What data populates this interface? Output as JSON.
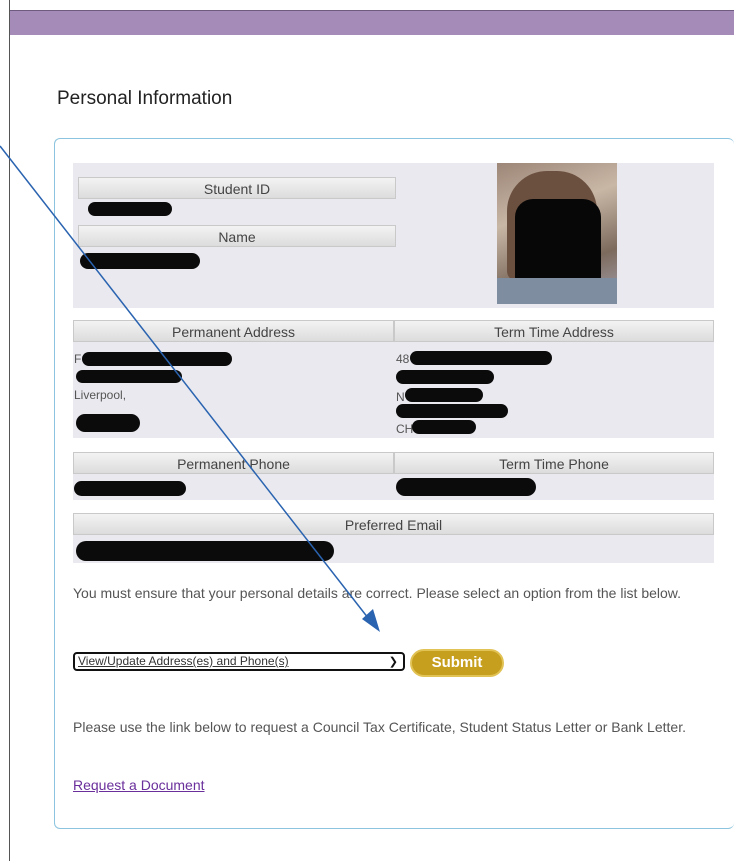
{
  "page": {
    "heading": "Personal Information"
  },
  "profile": {
    "student_id_label": "Student ID",
    "name_label": "Name",
    "photo_alt": "Student photo"
  },
  "addresses": {
    "permanent_label": "Permanent Address",
    "term_label": "Term Time Address",
    "permanent_city": "Liverpool,",
    "permanent_line1_fragment": "F",
    "term_line1_fragment": "48",
    "term_line3_fragment": "N",
    "term_line4_fragment": "CH"
  },
  "phones": {
    "permanent_label": "Permanent Phone",
    "term_label": "Term Time Phone"
  },
  "email": {
    "label": "Preferred Email"
  },
  "instructions": {
    "details_notice": "You must ensure that your personal details are correct. Please select an option from the list below.",
    "document_notice": "Please use the link below to request a Council Tax Certificate, Student Status Letter or Bank Letter."
  },
  "action_select": {
    "selected": "View/Update Address(es) and Phone(s)"
  },
  "submit_label": "Submit",
  "request_link": "Request a Document",
  "colors": {
    "header_bar": "#a58bb8",
    "card_border": "#8cc3de",
    "submit": "#c79f1f",
    "link": "#6a2f9b",
    "annotation_arrow": "#2a63b0"
  }
}
